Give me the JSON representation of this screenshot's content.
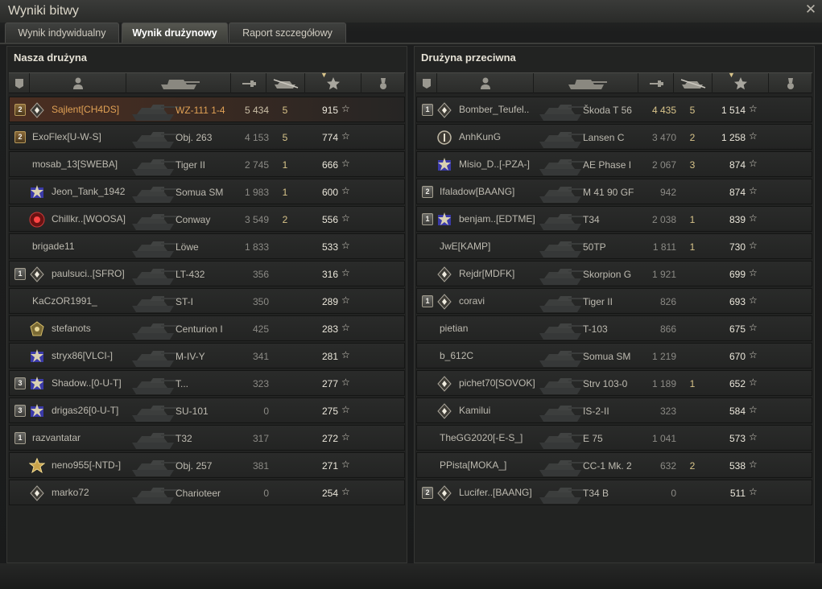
{
  "window": {
    "title": "Wyniki bitwy",
    "close_icon": "close-icon"
  },
  "tabs": [
    "Wynik indywidualny",
    "Wynik drużynowy",
    "Raport szczegółowy"
  ],
  "active_tab": 1,
  "teams": [
    {
      "title": "Nasza drużyna",
      "rows": [
        {
          "badge": "2",
          "emblem": "diamond-emblem",
          "name": "Sajlent[CH4DS]",
          "tank": "WZ-111 1-4",
          "damage": "5 434",
          "frags": "5",
          "xp": "915",
          "highlight": true,
          "gold": true
        },
        {
          "badge": "2",
          "emblem": "",
          "name": "ExoFlex[U-W-S]",
          "tank": "Obj. 263",
          "damage": "4 153",
          "frags": "5",
          "xp": "774",
          "gold": true
        },
        {
          "badge": "",
          "emblem": "",
          "name": "mosab_13[SWEBA]",
          "tank": "Tiger II",
          "damage": "2 745",
          "frags": "1",
          "xp": "666"
        },
        {
          "badge": "",
          "emblem": "star-emblem",
          "name": "Jeon_Tank_1942",
          "tank": "Somua SM",
          "damage": "1 983",
          "frags": "1",
          "xp": "600"
        },
        {
          "badge": "",
          "emblem": "red-emblem",
          "name": "Chillkr..[WOOSA]",
          "tank": "Conway",
          "damage": "3 549",
          "frags": "2",
          "xp": "556"
        },
        {
          "badge": "",
          "emblem": "",
          "name": "brigade11",
          "tank": "Löwe",
          "damage": "1 833",
          "frags": "",
          "xp": "533"
        },
        {
          "badge": "1",
          "emblem": "diamond-emblem",
          "name": "paulsuci..[SFRO]",
          "tank": "LT-432",
          "damage": "356",
          "frags": "",
          "xp": "316"
        },
        {
          "badge": "",
          "emblem": "",
          "name": "KaCzOR1991_",
          "tank": "ST-I",
          "damage": "350",
          "frags": "",
          "xp": "289"
        },
        {
          "badge": "",
          "emblem": "medal-emblem",
          "name": "stefanots",
          "tank": "Centurion I",
          "damage": "425",
          "frags": "",
          "xp": "283"
        },
        {
          "badge": "",
          "emblem": "star-emblem",
          "name": "stryx86[VLCI-]",
          "tank": "M-IV-Y",
          "damage": "341",
          "frags": "",
          "xp": "281"
        },
        {
          "badge": "3",
          "emblem": "star-emblem",
          "name": "Shadow..[0-U-T]",
          "tank": "T...",
          "damage": "323",
          "frags": "",
          "xp": "277"
        },
        {
          "badge": "3",
          "emblem": "star-emblem",
          "name": "drigas26[0-U-T]",
          "tank": "SU-101",
          "damage": "0",
          "frags": "",
          "xp": "275"
        },
        {
          "badge": "1",
          "emblem": "",
          "name": "razvantatar",
          "tank": "T32",
          "damage": "317",
          "frags": "",
          "xp": "272"
        },
        {
          "badge": "",
          "emblem": "gold-emblem",
          "name": "neno955[-NTD-]",
          "tank": "Obj. 257",
          "damage": "381",
          "frags": "",
          "xp": "271"
        },
        {
          "badge": "",
          "emblem": "diamond-emblem",
          "name": "marko72",
          "tank": "Charioteer",
          "damage": "0",
          "frags": "",
          "xp": "254"
        }
      ]
    },
    {
      "title": "Drużyna przeciwna",
      "rows": [
        {
          "badge": "1",
          "emblem": "diamond-emblem",
          "name": "Bomber_Teufel..",
          "tank": "Škoda T 56",
          "damage": "4 435",
          "frags": "5",
          "xp": "1 514",
          "dmg_bright": true
        },
        {
          "badge": "",
          "emblem": "ring-emblem",
          "name": "AnhKunG",
          "tank": "Lansen C",
          "damage": "3 470",
          "frags": "2",
          "xp": "1 258"
        },
        {
          "badge": "",
          "emblem": "star-emblem",
          "name": "Misio_D..[-PZA-]",
          "tank": "AE Phase I",
          "damage": "2 067",
          "frags": "3",
          "xp": "874"
        },
        {
          "badge": "2",
          "emblem": "",
          "name": "Ifaladow[BAANG]",
          "tank": "M 41 90 GF",
          "damage": "942",
          "frags": "",
          "xp": "874"
        },
        {
          "badge": "1",
          "emblem": "star-emblem",
          "name": "benjam..[EDTME]",
          "tank": "T34",
          "damage": "2 038",
          "frags": "1",
          "xp": "839"
        },
        {
          "badge": "",
          "emblem": "",
          "name": "JwE[KAMP]",
          "tank": "50TP",
          "damage": "1 811",
          "frags": "1",
          "xp": "730"
        },
        {
          "badge": "",
          "emblem": "diamond-emblem",
          "name": "Rejdr[MDFK]",
          "tank": "Skorpion G",
          "damage": "1 921",
          "frags": "",
          "xp": "699"
        },
        {
          "badge": "1",
          "emblem": "diamond-emblem",
          "name": "coravi",
          "tank": "Tiger II",
          "damage": "826",
          "frags": "",
          "xp": "693"
        },
        {
          "badge": "",
          "emblem": "",
          "name": "pietian",
          "tank": "T-103",
          "damage": "866",
          "frags": "",
          "xp": "675"
        },
        {
          "badge": "",
          "emblem": "",
          "name": "b_612C",
          "tank": "Somua SM",
          "damage": "1 219",
          "frags": "",
          "xp": "670"
        },
        {
          "badge": "",
          "emblem": "diamond-emblem",
          "name": "pichet70[SOVOK]",
          "tank": "Strv 103-0",
          "damage": "1 189",
          "frags": "1",
          "xp": "652"
        },
        {
          "badge": "",
          "emblem": "diamond-emblem",
          "name": "Kamilui",
          "tank": "IS-2-II",
          "damage": "323",
          "frags": "",
          "xp": "584"
        },
        {
          "badge": "",
          "emblem": "",
          "name": "TheGG2020[-E-S_]",
          "tank": "E 75",
          "damage": "1 041",
          "frags": "",
          "xp": "573"
        },
        {
          "badge": "",
          "emblem": "",
          "name": "PPista[MOKA_]",
          "tank": "CC-1 Mk. 2",
          "damage": "632",
          "frags": "2",
          "xp": "538"
        },
        {
          "badge": "2",
          "emblem": "diamond-emblem",
          "name": "Lucifer..[BAANG]",
          "tank": "T34 B",
          "damage": "0",
          "frags": "",
          "xp": "511"
        }
      ]
    }
  ],
  "columns": [
    "squad-icon",
    "player-icon",
    "tank-icon",
    "damage-icon",
    "frags-icon",
    "xp-star-icon",
    "medal-icon"
  ],
  "star_glyph": "☆",
  "colors": {
    "highlight": "#e0a155",
    "frags": "#d8c48a",
    "xp": "#ebe7db"
  }
}
